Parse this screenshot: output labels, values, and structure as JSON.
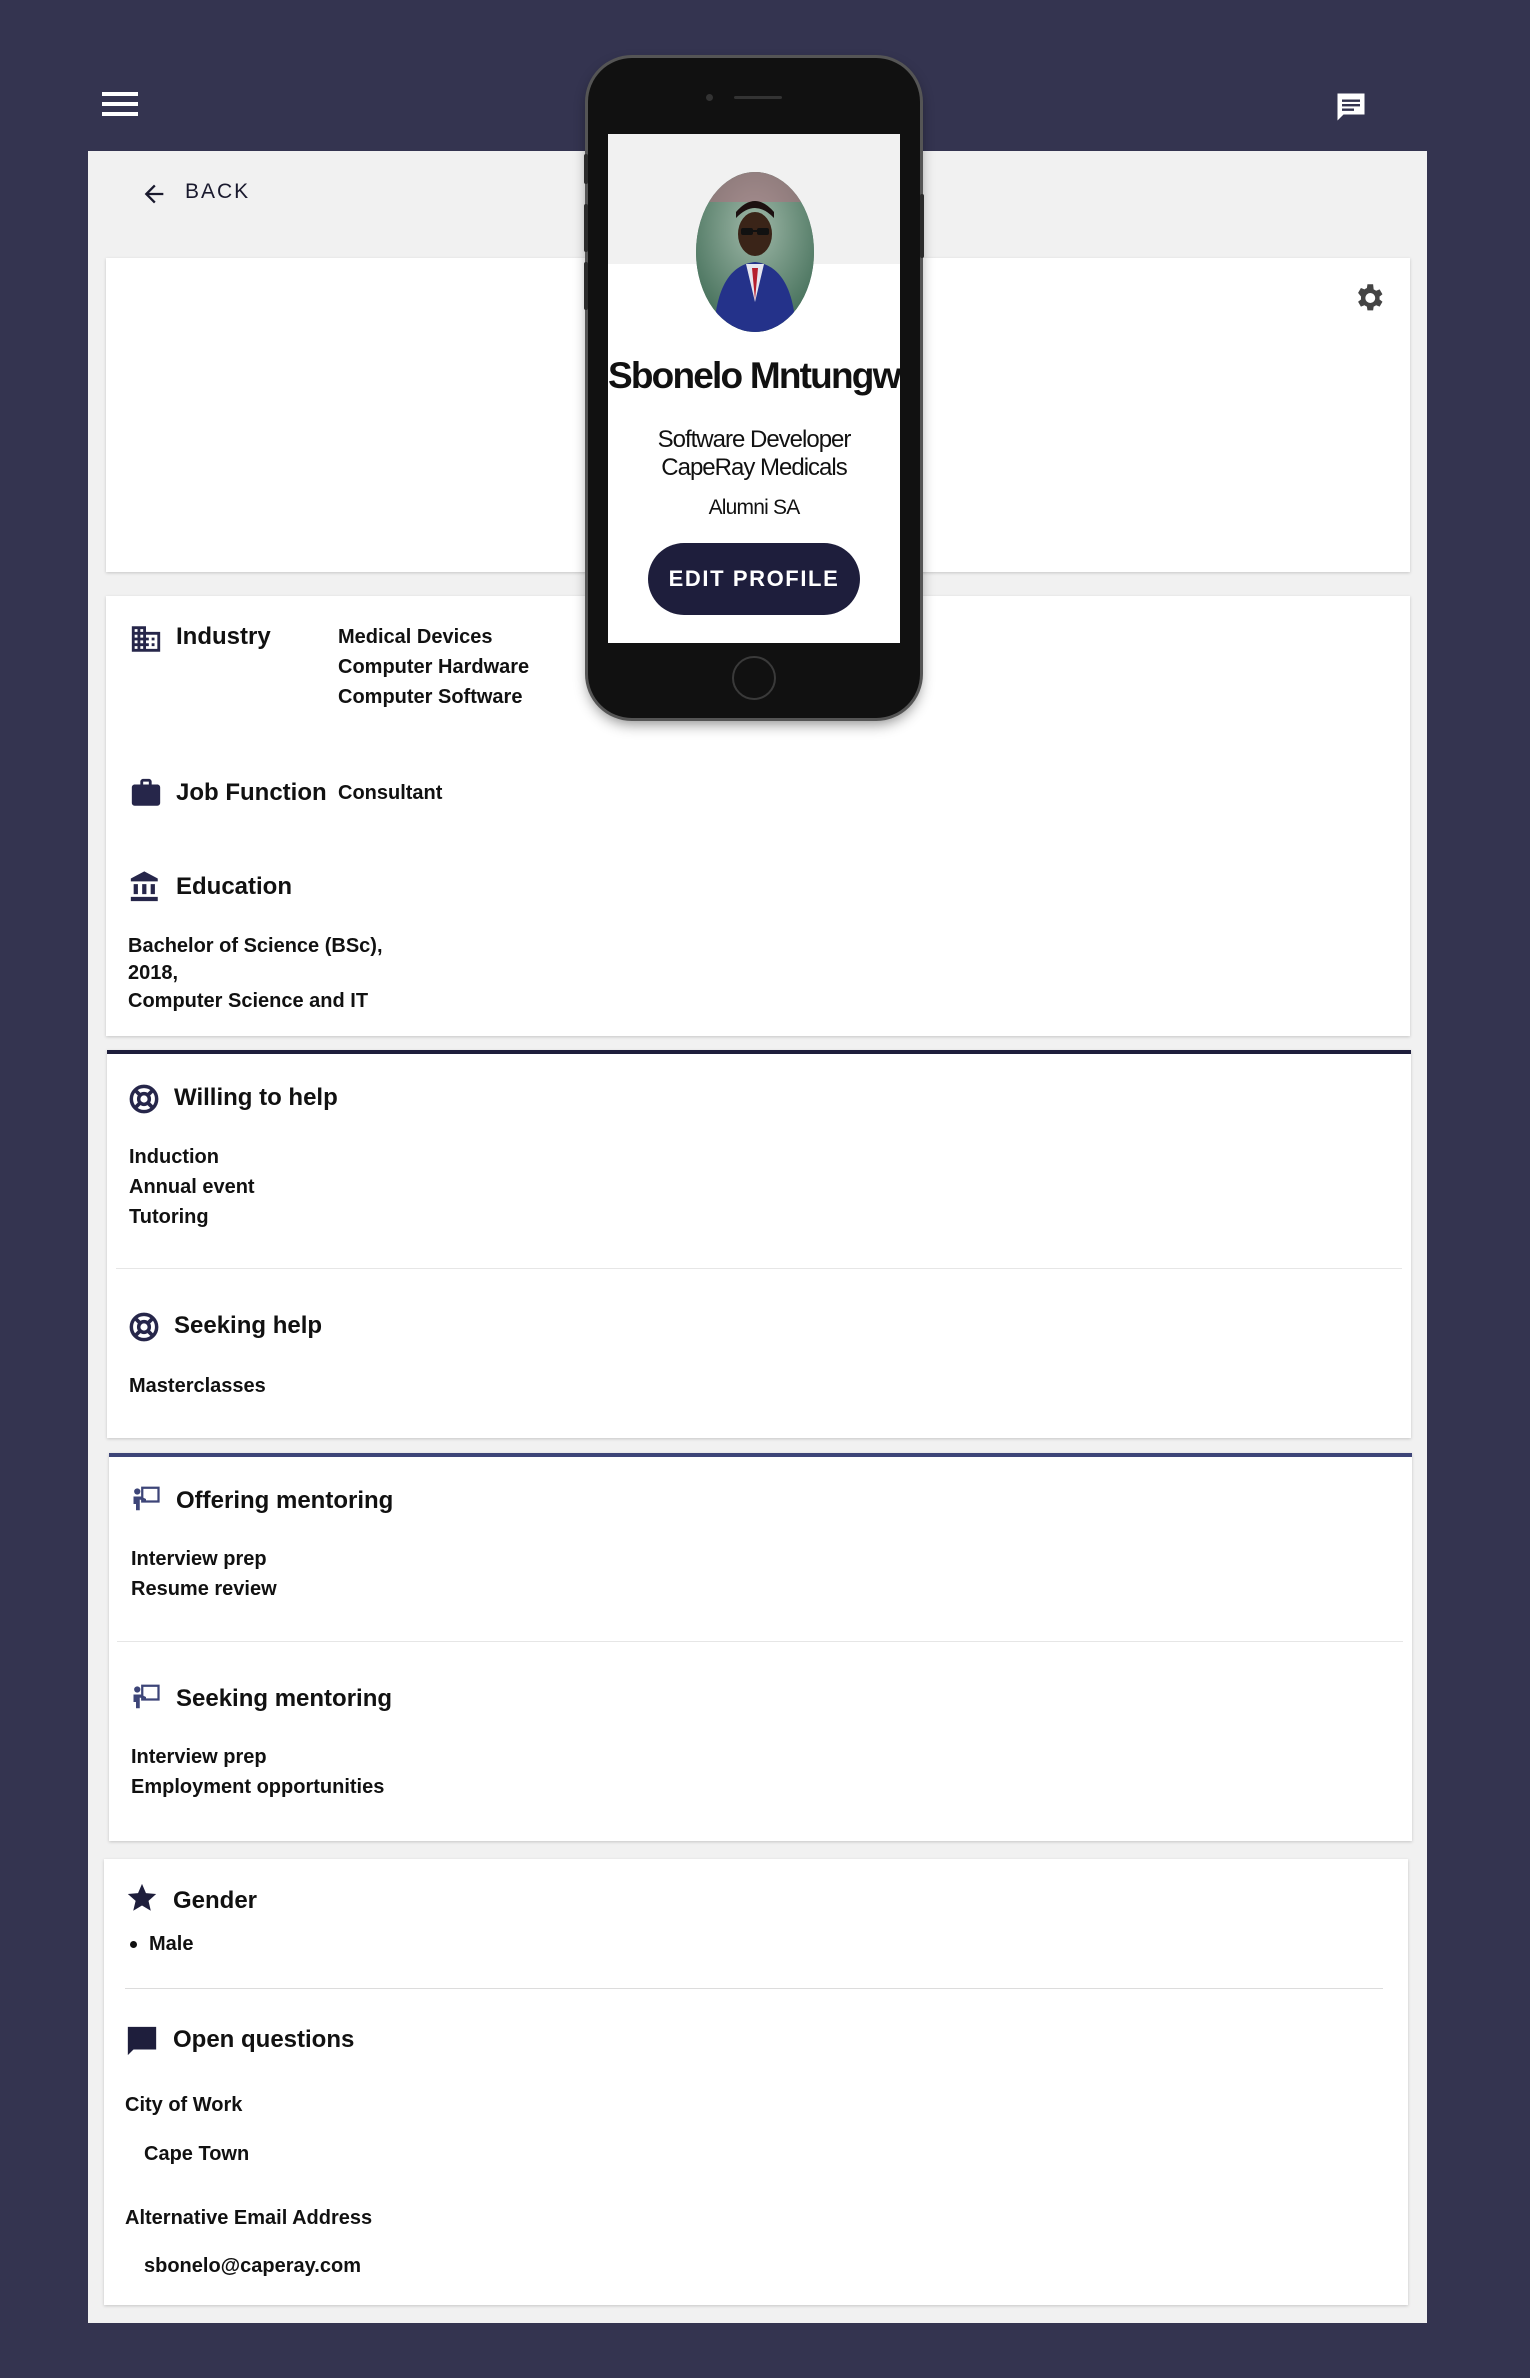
{
  "header": {
    "menu_icon": "hamburger-icon",
    "chat_icon": "chat-icon",
    "back_label": "BACK",
    "settings_icon": "gear-icon"
  },
  "profile": {
    "name": "Sbonelo Mntungwa",
    "title": "Software Developer",
    "company": "CapeRay Medicals",
    "group": "Alumni SA",
    "edit_label": "EDIT PROFILE",
    "accent_color": "#1e1e3c"
  },
  "details": {
    "industry_label": "Industry",
    "industries": [
      "Medical Devices",
      "Computer Hardware",
      "Computer Software"
    ],
    "job_function_label": "Job Function",
    "job_function": "Consultant",
    "education_label": "Education",
    "education_lines": [
      "Bachelor of Science (BSc),",
      "2018,",
      "Computer Science and IT"
    ]
  },
  "help": {
    "willing_label": "Willing to help",
    "willing_items": [
      "Induction",
      "Annual event",
      "Tutoring"
    ],
    "seeking_label": "Seeking help",
    "seeking_items": [
      "Masterclasses"
    ]
  },
  "mentoring": {
    "offering_label": "Offering mentoring",
    "offering_items": [
      "Interview prep",
      "Resume review"
    ],
    "seeking_label": "Seeking mentoring",
    "seeking_items": [
      "Interview prep",
      "Employment opportunities"
    ]
  },
  "extra": {
    "gender_label": "Gender",
    "gender_value": "Male",
    "open_questions_label": "Open questions",
    "city_label": "City of Work",
    "city_value": "Cape Town",
    "alt_email_label": "Alternative Email Address",
    "alt_email_value": "sbonelo@caperay.com"
  }
}
